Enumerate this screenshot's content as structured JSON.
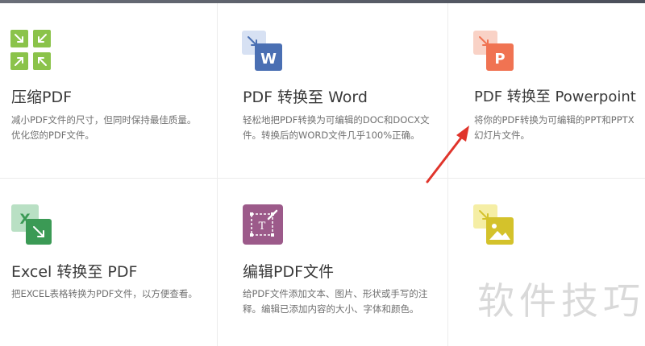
{
  "tools": [
    {
      "title": "压缩PDF",
      "desc": "减小PDF文件的尺寸，但同时保持最佳质量。优化您的PDF文件。",
      "icon": "compress-icon",
      "color": "#8bc34a"
    },
    {
      "title": "PDF 转换至 Word",
      "desc": "轻松地把PDF转换为可编辑的DOC和DOCX文件。转换后的WORD文件几乎100%正确。",
      "icon": "word-icon",
      "icon_letter": "W",
      "color": "#4a6fb3"
    },
    {
      "title": "PDF 转换至 Powerpoint",
      "desc": "将你的PDF转换为可编辑的PPT和PPTX幻灯片文件。",
      "icon": "powerpoint-icon",
      "icon_letter": "P",
      "color": "#f07352"
    },
    {
      "title": "Excel 转换至 PDF",
      "desc": "把EXCEL表格转换为PDF文件，以方便查看。",
      "icon": "excel-icon",
      "icon_letter": "X",
      "color": "#3b9a55"
    },
    {
      "title": "编辑PDF文件",
      "desc": "给PDF文件添加文本、图片、形状或手写的注释。编辑已添加内容的大小、字体和颜色。",
      "icon": "edit-icon",
      "color": "#9c5a8a"
    },
    {
      "title": "",
      "desc": "",
      "icon": "image-icon",
      "color": "#d4c22b"
    }
  ],
  "watermark": "软件技巧",
  "annotation_color": "#e0342b"
}
